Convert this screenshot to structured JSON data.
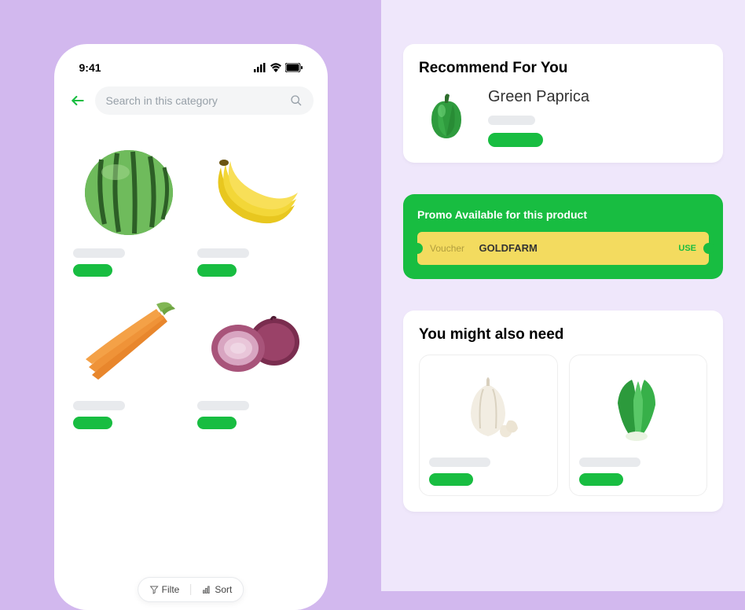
{
  "status": {
    "time": "9:41"
  },
  "search": {
    "placeholder": "Search in this category"
  },
  "products": [
    {
      "name": "Watermelon"
    },
    {
      "name": "Banana"
    },
    {
      "name": "Carrots"
    },
    {
      "name": "Red Onion"
    }
  ],
  "filter_sort": {
    "filter": "Filte",
    "sort": "Sort"
  },
  "recommend": {
    "title": "Recommend For You",
    "product_name": "Green Paprica"
  },
  "promo": {
    "title": "Promo Available for this product",
    "voucher_label": "Voucher",
    "code": "GOLDFARM",
    "use_label": "USE"
  },
  "also_need": {
    "title": "You might also need",
    "items": [
      {
        "name": "Garlic"
      },
      {
        "name": "Bok Choy"
      }
    ]
  },
  "colors": {
    "accent": "#18bd41",
    "voucher_bg": "#f3db5f"
  }
}
